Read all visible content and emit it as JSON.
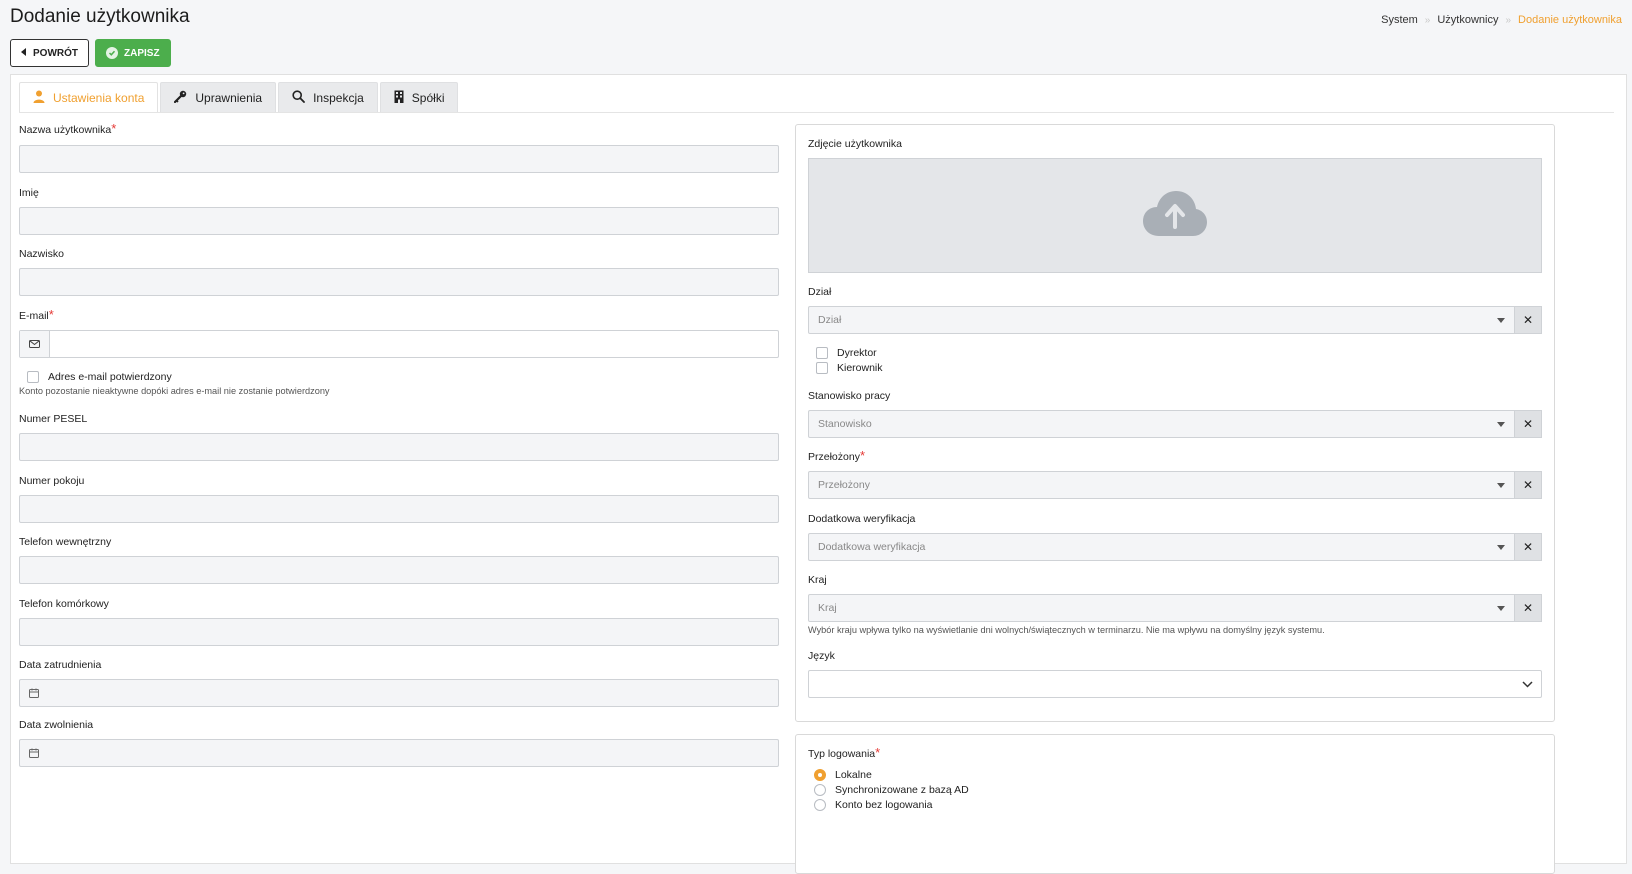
{
  "header": {
    "title": "Dodanie użytkownika",
    "breadcrumb": [
      "System",
      "Użytkownicy",
      "Dodanie użytkownika"
    ]
  },
  "actions": {
    "back_label": "POWRÓT",
    "save_label": "ZAPISZ"
  },
  "colors": {
    "accent": "#f0a030",
    "save": "#4cae4c",
    "required": "#e53935"
  },
  "tabs": [
    {
      "label": "Ustawienia konta",
      "icon": "user-icon",
      "active": true
    },
    {
      "label": "Uprawnienia",
      "icon": "key-icon",
      "active": false
    },
    {
      "label": "Inspekcja",
      "icon": "search-icon",
      "active": false
    },
    {
      "label": "Spółki",
      "icon": "building-icon",
      "active": false
    }
  ],
  "left": {
    "username_label": "Nazwa użytkownika",
    "firstname_label": "Imię",
    "lastname_label": "Nazwisko",
    "email_label": "E-mail",
    "email_confirmed_label": "Adres e-mail potwierdzony",
    "email_hint": "Konto pozostanie nieaktywne dopóki adres e-mail nie zostanie potwierdzony",
    "pesel_label": "Numer PESEL",
    "room_label": "Numer pokoju",
    "phone_internal_label": "Telefon wewnętrzny",
    "phone_mobile_label": "Telefon komórkowy",
    "hire_date_label": "Data zatrudnienia",
    "release_date_label": "Data zwolnienia"
  },
  "right": {
    "photo_label": "Zdjęcie użytkownika",
    "department_label": "Dział",
    "department_placeholder": "Dział",
    "director_label": "Dyrektor",
    "manager_label": "Kierownik",
    "position_label": "Stanowisko pracy",
    "position_placeholder": "Stanowisko",
    "supervisor_label": "Przełożony",
    "supervisor_placeholder": "Przełożony",
    "verification_label": "Dodatkowa weryfikacja",
    "verification_placeholder": "Dodatkowa weryfikacja",
    "country_label": "Kraj",
    "country_placeholder": "Kraj",
    "country_hint": "Wybór kraju wpływa tylko na wyświetlanie dni wolnych/świątecznych w terminarzu. Nie ma wpływu na domyślny język systemu.",
    "language_label": "Język",
    "language_value": ""
  },
  "login": {
    "label": "Typ logowania",
    "options": [
      {
        "label": "Lokalne",
        "selected": true
      },
      {
        "label": "Synchronizowane z bazą AD",
        "selected": false
      },
      {
        "label": "Konto bez logowania",
        "selected": false
      }
    ]
  }
}
